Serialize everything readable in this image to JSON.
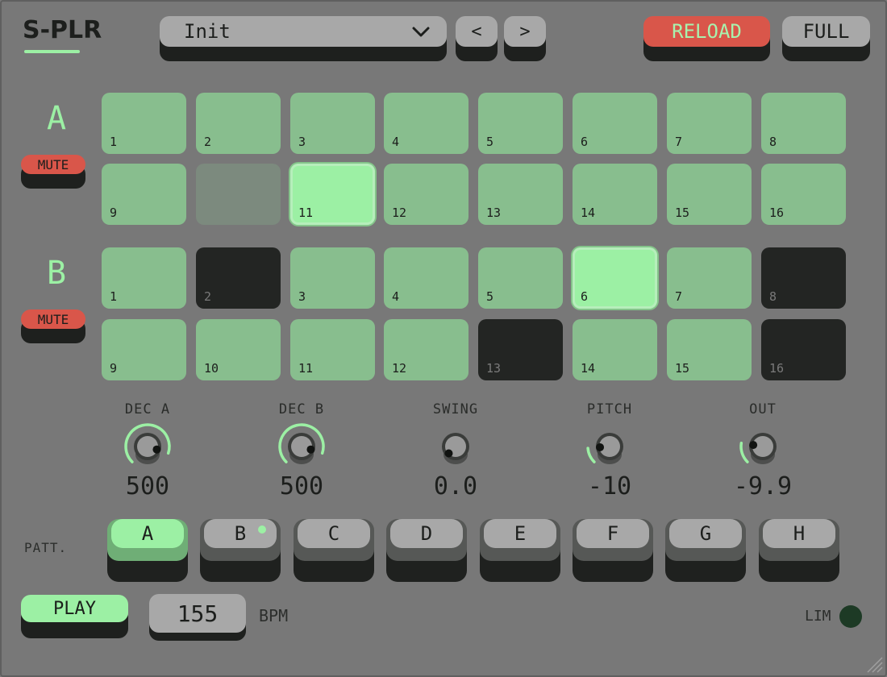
{
  "app": {
    "logo": "S-PLR"
  },
  "header": {
    "preset_name": "Init",
    "prev_label": "<",
    "next_label": ">",
    "reload_label": "RELOAD",
    "full_label": "FULL"
  },
  "tracks": [
    {
      "letter": "A",
      "mute_label": "MUTE",
      "steps": [
        {
          "n": "1",
          "state": "on"
        },
        {
          "n": "2",
          "state": "on"
        },
        {
          "n": "3",
          "state": "on"
        },
        {
          "n": "4",
          "state": "on"
        },
        {
          "n": "5",
          "state": "on"
        },
        {
          "n": "6",
          "state": "on"
        },
        {
          "n": "7",
          "state": "on"
        },
        {
          "n": "8",
          "state": "on"
        },
        {
          "n": "9",
          "state": "on"
        },
        {
          "n": "",
          "state": "dim"
        },
        {
          "n": "11",
          "state": "active"
        },
        {
          "n": "12",
          "state": "on"
        },
        {
          "n": "13",
          "state": "on"
        },
        {
          "n": "14",
          "state": "on"
        },
        {
          "n": "15",
          "state": "on"
        },
        {
          "n": "16",
          "state": "on"
        }
      ]
    },
    {
      "letter": "B",
      "mute_label": "MUTE",
      "steps": [
        {
          "n": "1",
          "state": "on"
        },
        {
          "n": "2",
          "state": "off"
        },
        {
          "n": "3",
          "state": "on"
        },
        {
          "n": "4",
          "state": "on"
        },
        {
          "n": "5",
          "state": "on"
        },
        {
          "n": "6",
          "state": "active"
        },
        {
          "n": "7",
          "state": "on"
        },
        {
          "n": "8",
          "state": "off"
        },
        {
          "n": "9",
          "state": "on"
        },
        {
          "n": "10",
          "state": "on"
        },
        {
          "n": "11",
          "state": "on"
        },
        {
          "n": "12",
          "state": "on"
        },
        {
          "n": "13",
          "state": "off"
        },
        {
          "n": "14",
          "state": "on"
        },
        {
          "n": "15",
          "state": "on"
        },
        {
          "n": "16",
          "state": "off"
        }
      ]
    }
  ],
  "knobs": [
    {
      "label": "DEC A",
      "value": "500",
      "level": 0.9
    },
    {
      "label": "DEC B",
      "value": "500",
      "level": 0.9
    },
    {
      "label": "SWING",
      "value": "0.0",
      "level": 0.0
    },
    {
      "label": "PITCH",
      "value": "-10",
      "level": 0.15
    },
    {
      "label": "OUT",
      "value": "-9.9",
      "level": 0.2
    }
  ],
  "patterns": {
    "label": "PATT.",
    "items": [
      {
        "label": "A",
        "selected": true,
        "has_data": false
      },
      {
        "label": "B",
        "selected": false,
        "has_data": true
      },
      {
        "label": "C",
        "selected": false,
        "has_data": false
      },
      {
        "label": "D",
        "selected": false,
        "has_data": false
      },
      {
        "label": "E",
        "selected": false,
        "has_data": false
      },
      {
        "label": "F",
        "selected": false,
        "has_data": false
      },
      {
        "label": "G",
        "selected": false,
        "has_data": false
      },
      {
        "label": "H",
        "selected": false,
        "has_data": false
      }
    ]
  },
  "transport": {
    "play_label": "PLAY",
    "bpm_value": "155",
    "bpm_label": "BPM",
    "lim_label": "LIM"
  },
  "colors": {
    "accent_green": "#9cf0a4",
    "pad_on": "#88be8e",
    "pad_off": "#232523",
    "alert_red": "#d9564a",
    "background": "#787878"
  }
}
